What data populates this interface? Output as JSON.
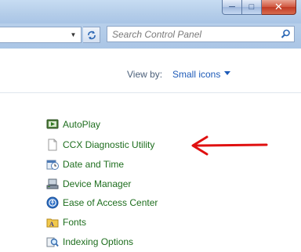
{
  "window": {
    "buttons": {
      "minimize_icon": "minimize-icon",
      "maximize_icon": "maximize-icon",
      "close_icon": "close-icon"
    }
  },
  "addressbar": {
    "search_placeholder": "Search Control Panel"
  },
  "view": {
    "label": "View by:",
    "value": "Small icons"
  },
  "items": [
    {
      "label": "AutoPlay",
      "icon": "autoplay-icon"
    },
    {
      "label": "CCX Diagnostic Utility",
      "icon": "document-icon"
    },
    {
      "label": "Date and Time",
      "icon": "calendar-clock-icon"
    },
    {
      "label": "Device Manager",
      "icon": "device-manager-icon"
    },
    {
      "label": "Ease of Access Center",
      "icon": "ease-of-access-icon"
    },
    {
      "label": "Fonts",
      "icon": "fonts-folder-icon"
    },
    {
      "label": "Indexing Options",
      "icon": "indexing-options-icon"
    }
  ],
  "colors": {
    "link_green": "#1e6e1e",
    "accent_blue": "#1e5bb8",
    "annotation_red": "#e01010"
  }
}
